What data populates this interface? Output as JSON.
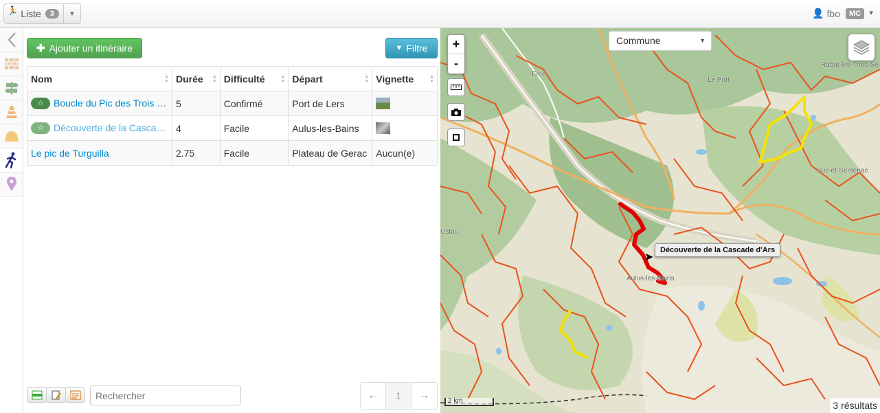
{
  "navbar": {
    "list_label": "Liste",
    "list_count": "3",
    "user_name": "fbo",
    "user_badge": "MC"
  },
  "sidebar": {
    "items": [
      {
        "icon": "collapse-icon",
        "glyph": "⟨"
      },
      {
        "icon": "wall-icon",
        "glyph": "▦"
      },
      {
        "icon": "signpost-icon",
        "glyph": "⊢"
      },
      {
        "icon": "cone-icon",
        "glyph": "▲"
      },
      {
        "icon": "helmet-icon",
        "glyph": "◓"
      },
      {
        "icon": "hiker-icon",
        "glyph": "🏃"
      },
      {
        "icon": "poi-pin-icon",
        "glyph": "⬤"
      }
    ]
  },
  "panel": {
    "add_button": "Ajouter un itinéraire",
    "filter_button": "Filtre",
    "columns": [
      "Nom",
      "Durée",
      "Difficulté",
      "Départ",
      "Vignette"
    ],
    "rows": [
      {
        "name": "Boucle du Pic des Trois …",
        "duration": "5",
        "difficulty": "Confirmé",
        "departure": "Port de Lers",
        "thumb": "",
        "starred": true
      },
      {
        "name": "Découverte de la Casca…",
        "duration": "4",
        "difficulty": "Facile",
        "departure": "Aulus-les-Bains",
        "thumb": "",
        "starred": true
      },
      {
        "name": "Le pic de Turguilla",
        "duration": "2.75",
        "difficulty": "Facile",
        "departure": "Plateau de Gerac",
        "thumb": "Aucun(e)",
        "starred": false
      }
    ],
    "search_placeholder": "Rechercher",
    "pager": {
      "prev": "←",
      "page": "1",
      "next": "→"
    }
  },
  "map": {
    "commune_select": "Commune",
    "zoom_in": "+",
    "zoom_out": "-",
    "tooltip": "Découverte de la Cascade d'Ars",
    "places": {
      "rabat": "Rabat-les-Trois-Sei",
      "erce": "Ercé",
      "le_port": "Le Port",
      "suc": "Suc-et-Sentenac",
      "ustou": "Ustou",
      "aulus": "Aulus-les-Bains"
    },
    "scale": "2 km",
    "results": "3 résultats"
  },
  "colors": {
    "trail_other": "#e8541e",
    "trail_selected": "#e00000",
    "trail_highlight": "#f5e200",
    "add_green": "#51a351",
    "filter_blue": "#2f96b4"
  }
}
